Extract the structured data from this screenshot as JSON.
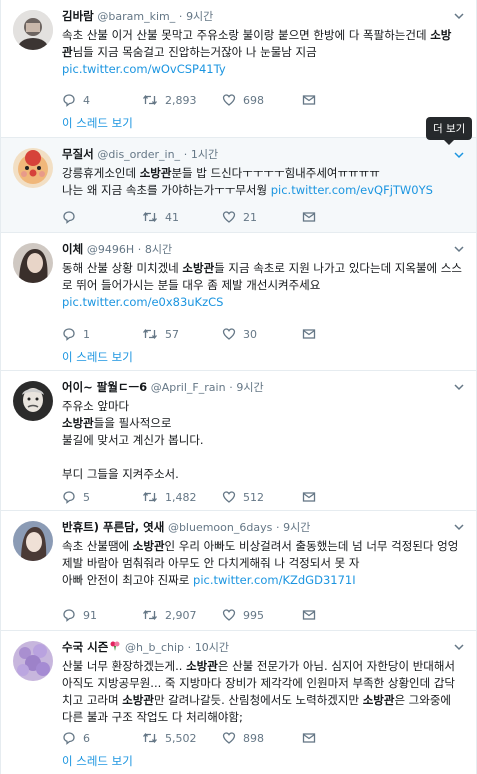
{
  "tooltip": "더 보기",
  "thread_label": "이 스레드 보기",
  "tweets": [
    {
      "name": "김바람",
      "handle": "@baram_kim_",
      "sep": "·",
      "time": "9시간",
      "line1": "속초 산불 이거 산불 못막고 주유소랑 불이랑 붙으면 한방에 다 폭팔하는건데 ",
      "bold1": "소방",
      "line2a": "관",
      "line2b": "님들 지금 목숨걸고 진압하는거잖아 나 눈물남 지금",
      "link": "pic.twitter.com/wOvCSP41Ty",
      "replies": "4",
      "retweets": "2,893",
      "likes": "698"
    },
    {
      "name": "무질서",
      "handle": "@dis_order_in_",
      "sep": "·",
      "time": "1시간",
      "line1": "강릉휴게소인데 ",
      "bold1": "소방관",
      "line1b": "분들 밥 드신다ㅜㅜㅜㅜ힘내주세여ㅠㅠㅠㅠ",
      "line2": "나는 왜 지금 속초를 가야하는가ㅜㅜ무서웡 ",
      "link": "pic.twitter.com/evQFjTW0YS",
      "replies": "",
      "retweets": "41",
      "likes": "21"
    },
    {
      "name": "이체",
      "handle": "@9496H",
      "sep": "·",
      "time": "8시간",
      "line1": "동해 산불 상황 미치겠네 ",
      "bold1": "소방관",
      "line1b": "들 지금 속초로 지원 나가고 있다는데 지옥불에 스스로 뛰어 들어가시는 분들 대우 좀 제발 개선시켜주세요",
      "link": "pic.twitter.com/e0x83uKzCS",
      "replies": "1",
      "retweets": "57",
      "likes": "30"
    },
    {
      "name": "어이~ 팔월ㄷㅡ6",
      "handle": "@April_F_rain",
      "sep": "·",
      "time": "9시간",
      "line1": "주유소 앞마다",
      "bold1": "소방관",
      "line2": "들을 필사적으로",
      "line3": "불길에 맞서고 계신가 봅니다.",
      "line4": "부디 그들을 지켜주소서.",
      "replies": "5",
      "retweets": "1,482",
      "likes": "512"
    },
    {
      "name": "반휴트) 푸른담, 엿새",
      "handle": "@bluemoon_6days",
      "sep": "·",
      "time": "9시간",
      "line1": "속초 산불땜에 ",
      "bold1": "소방관",
      "line1b": "인 우리 아빠도 비상걸려서 출동했는데 넘 너무 걱정된다 엉엉 제발 바람아 멈춰줘라 아무도 안 다치게해줘 나 걱정되서 못 자",
      "line2": "아빠 안전이 최고야 진짜로 ",
      "link": "pic.twitter.com/KZdGD3171I",
      "replies": "91",
      "retweets": "2,907",
      "likes": "995"
    },
    {
      "name": "수국 시즌",
      "handle": "@h_b_chip",
      "sep": "·",
      "time": "10시간",
      "line1": "산불 너무 환장하겠는게.. ",
      "bold1": "소방관",
      "line1b": "은 산불 전문가가 아님. 심지어 자한당이 반대해서 아직도 지방공무원... 죽 지방마다 장비가 제각각에 인원마저 부족한 상황인데 갑닥치고 고라며 ",
      "bold2": "소방관",
      "line1c": "만 갈려나갈듯. 산림청에서도 노력하겠지만 ",
      "bold3": "소방관",
      "line1d": "은 그와중에 다른 불과 구조 작업도 다 처리해야함;",
      "replies": "6",
      "retweets": "5,502",
      "likes": "898"
    }
  ],
  "colors": {
    "link": "#1b95e0",
    "muted": "#657786",
    "border": "#e6ecf0",
    "hover_bg": "#f5f8fa"
  }
}
